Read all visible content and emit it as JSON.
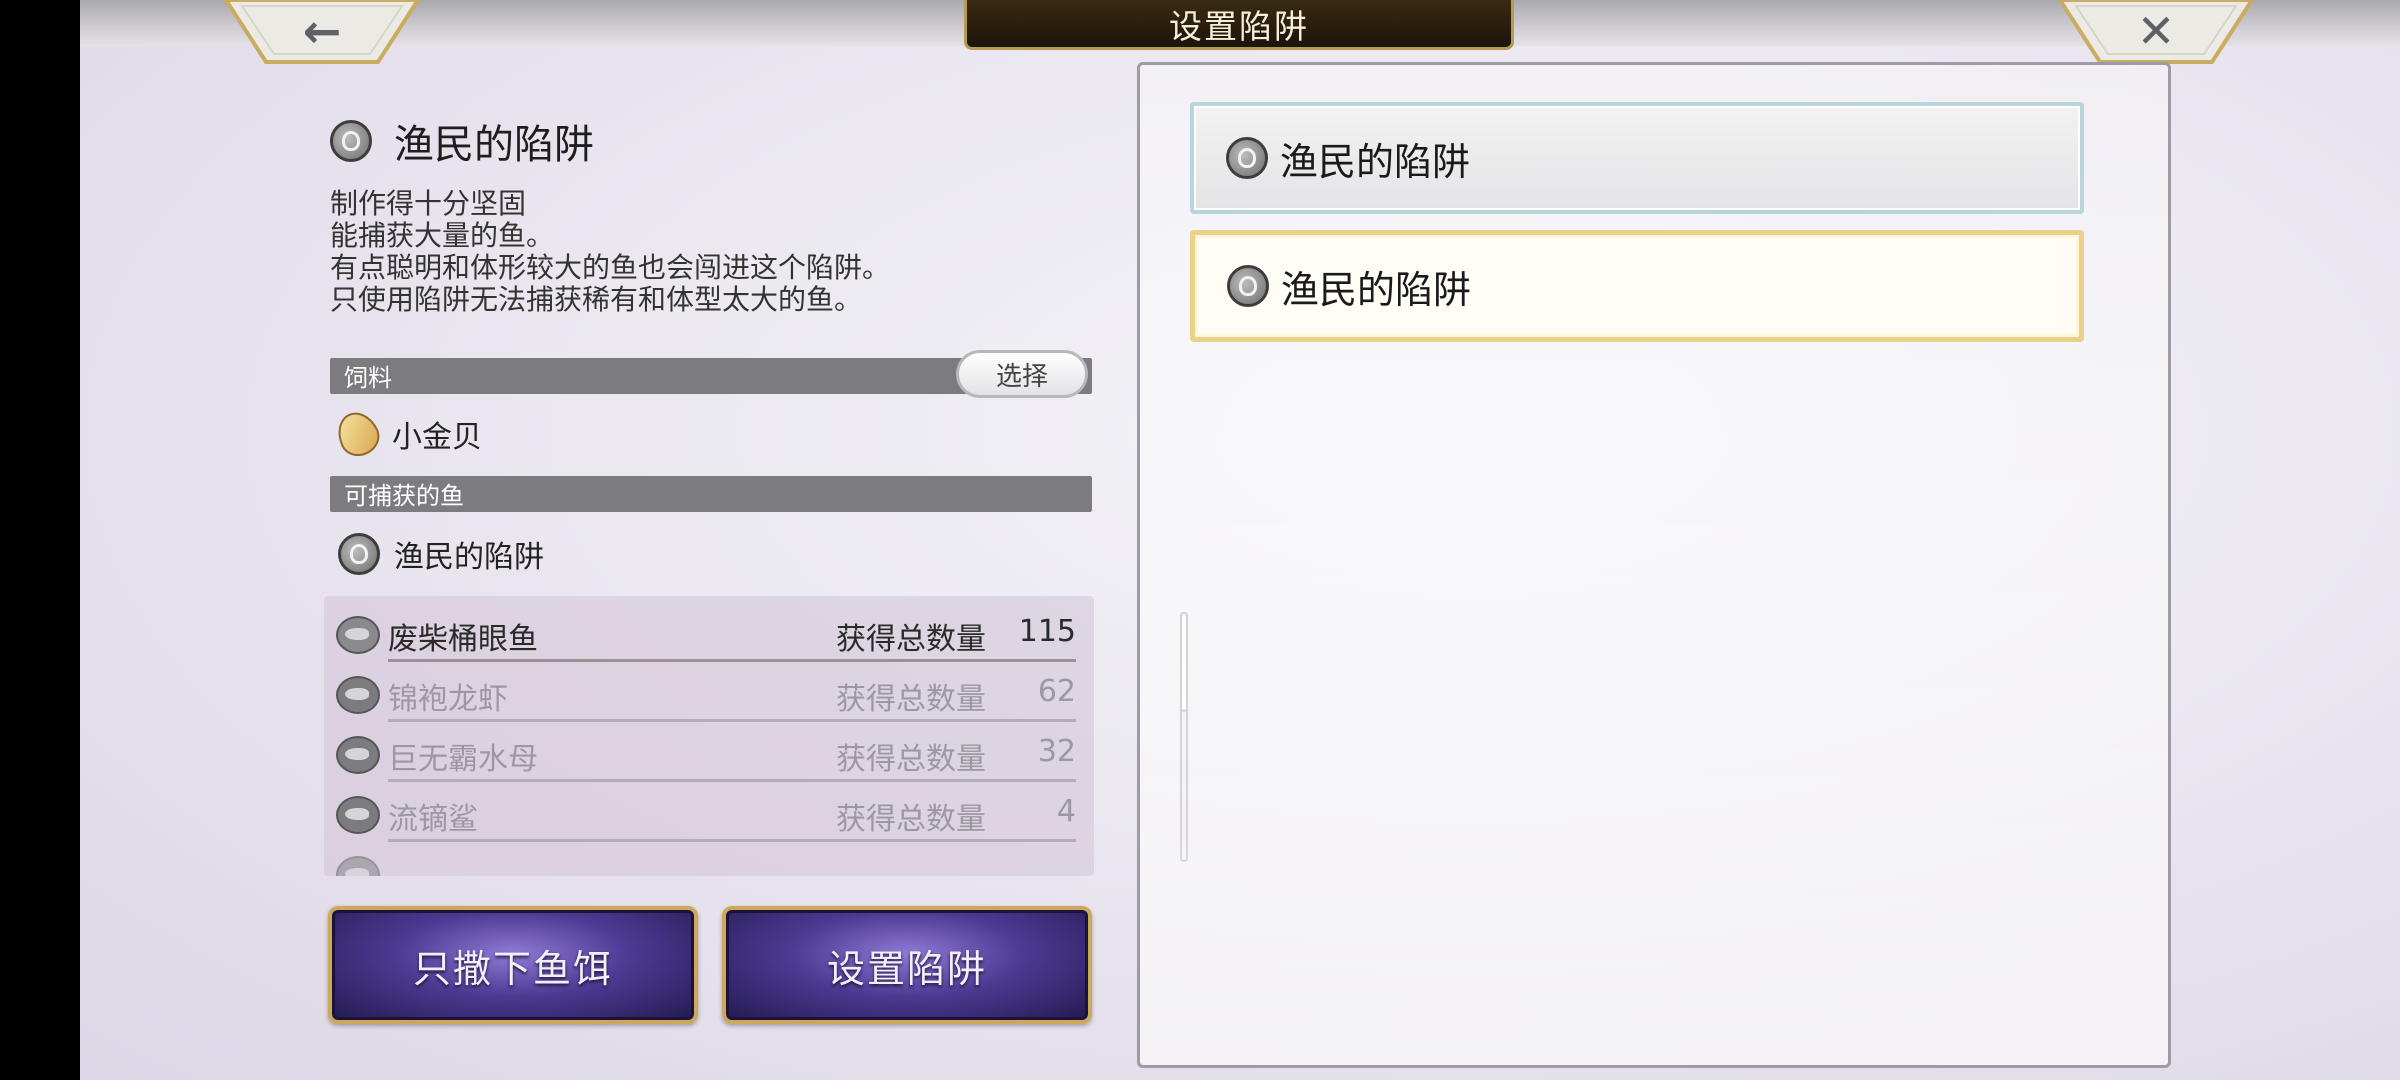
{
  "header": {
    "title": "设置陷阱",
    "back_icon": "arrow-left-icon",
    "close_icon": "close-icon"
  },
  "trap": {
    "name": "渔民的陷阱",
    "icon": "pot-icon",
    "description": [
      "制作得十分坚固",
      "能捕获大量的鱼。",
      "有点聪明和体形较大的鱼也会闯进这个陷阱。",
      "只使用陷阱无法捕获稀有和体型太大的鱼。"
    ]
  },
  "bait_section": {
    "label": "饲料",
    "select_label": "选择",
    "bait_name": "小金贝"
  },
  "catch_section": {
    "label": "可捕获的鱼",
    "trap_name": "渔民的陷阱",
    "count_label": "获得总数量",
    "fish": [
      {
        "name": "废柴桶眼鱼",
        "count": "115",
        "active": true
      },
      {
        "name": "锦袍龙虾",
        "count": "62",
        "active": false
      },
      {
        "name": "巨无霸水母",
        "count": "32",
        "active": false
      },
      {
        "name": "流镝鲨",
        "count": "4",
        "active": false
      }
    ]
  },
  "actions": {
    "remove_bait": "只撒下鱼饵",
    "set_trap": "设置陷阱"
  },
  "slots": [
    {
      "label": "渔民的陷阱"
    },
    {
      "label": "渔民的陷阱"
    }
  ],
  "colors": {
    "button_purple": "#4d3a93",
    "gold_border": "#caa85c",
    "section_bar": "#7c7b80"
  }
}
